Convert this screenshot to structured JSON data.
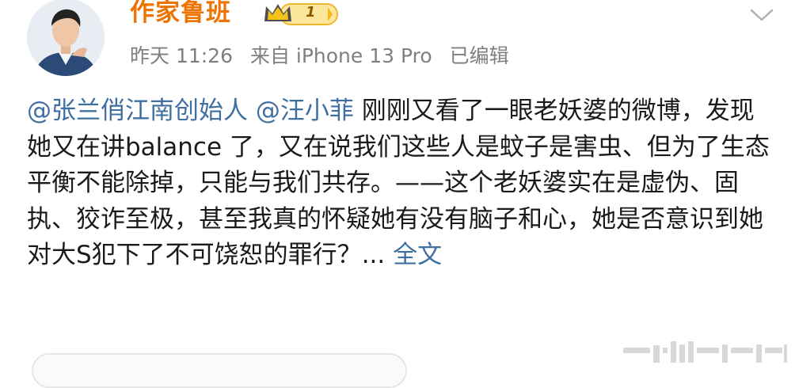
{
  "post": {
    "author": "作家鲁班",
    "vip_level": "1",
    "time": "昨天 11:26",
    "source": "来自 iPhone 13 Pro",
    "edited": "已编辑",
    "mention1": "@张兰俏江南创始人",
    "mention2": "@汪小菲",
    "body": " 刚刚又看了一眼老妖婆的微博，发现她又在讲balance 了，又在说我们这些人是蚊子是害虫、但为了生态平衡不能除掉，只能与我们共存。——这个老妖婆实在是虚伪、固执、狡诈至极，甚至我真的怀疑她有没有脑子和心，她是否意识到她对大S犯下了不可饶恕的罪行？",
    "ellipsis": "... ",
    "more_label": "全文"
  },
  "icons": {
    "avatar": "avatar-photo",
    "badge": "crown-vip-badge",
    "menu": "chevron-down-icon",
    "watermark": "watermark-bars"
  },
  "colors": {
    "username": "#ee7300",
    "link": "#3f6fa0",
    "meta": "#7f7f7f"
  }
}
